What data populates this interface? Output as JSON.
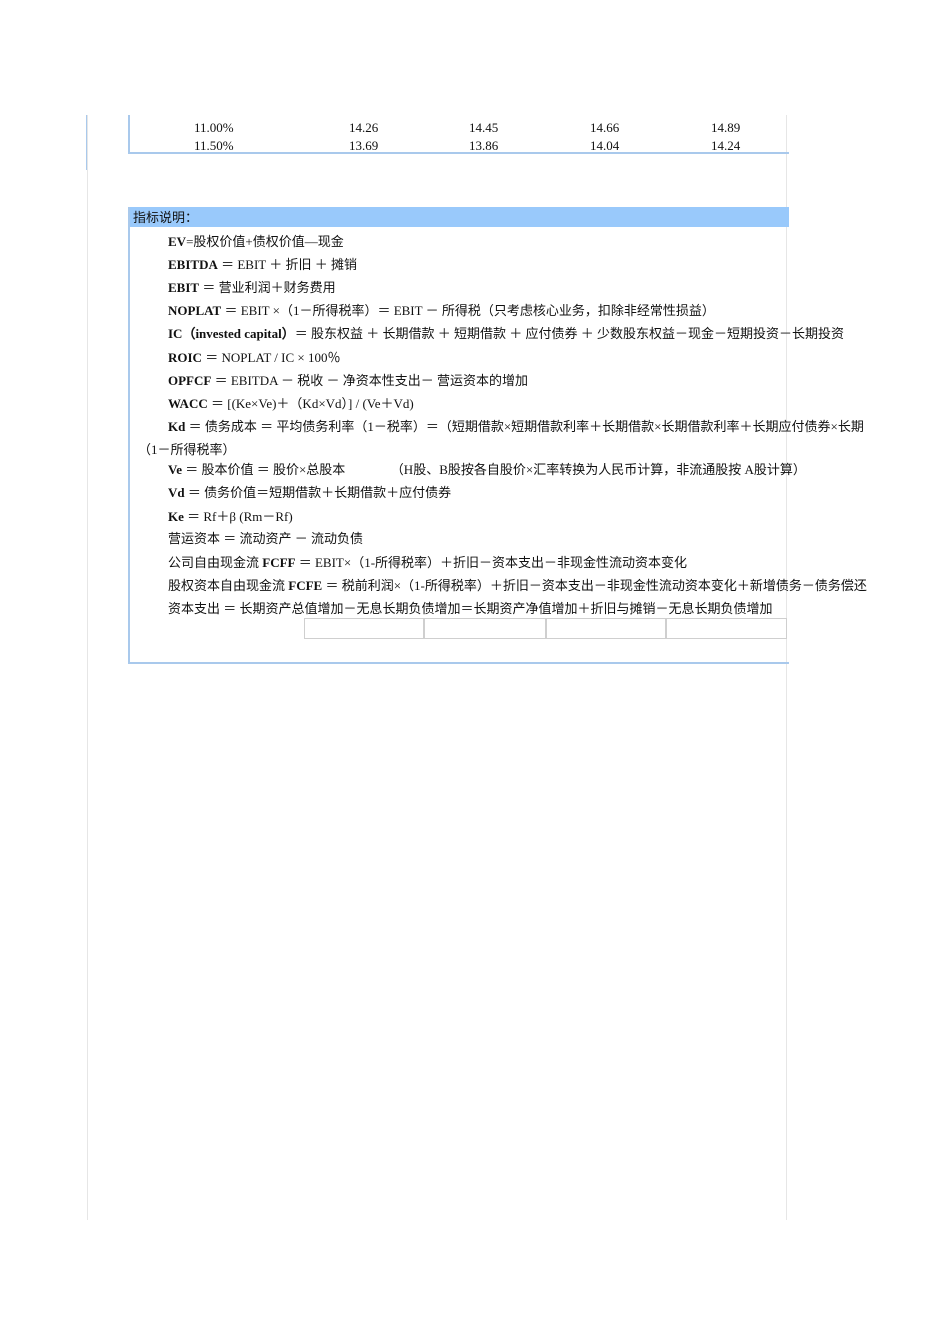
{
  "table": {
    "rows": [
      {
        "rate": "11.00%",
        "values": [
          "14.26",
          "14.45",
          "14.66",
          "14.89"
        ]
      },
      {
        "rate": "11.50%",
        "values": [
          "13.69",
          "13.86",
          "14.04",
          "14.24"
        ]
      }
    ]
  },
  "notes": {
    "header": "指标说明：",
    "lines": [
      {
        "term": "EV",
        "text": "=股权价值+债权价值—现金"
      },
      {
        "term": "EBITDA",
        "text": " ＝ EBIT ＋ 折旧 ＋ 摊销"
      },
      {
        "term": "EBIT",
        "text": " ＝ 营业利润＋财务费用"
      },
      {
        "term": "NOPLAT",
        "text": " ＝ EBIT ×（1－所得税率）＝ EBIT － 所得税（只考虑核心业务，扣除非经常性损益）"
      },
      {
        "term": "IC（invested capital）",
        "text": "＝ 股东权益 ＋ 长期借款 ＋ 短期借款 ＋ 应付债券 ＋ 少数股东权益－现金－短期投资－长期投资"
      },
      {
        "term": "ROIC",
        "text": " ＝ NOPLAT / IC × 100％"
      },
      {
        "term": "OPFCF",
        "text": " ＝ EBITDA － 税收 － 净资本性支出－ 营运资本的增加"
      },
      {
        "term": "WACC",
        "text": " ＝ [(Ke×Ve)＋（Kd×Vd）] / (Ve＋Vd)"
      },
      {
        "term": "Kd",
        "text": " ＝ 债务成本 ＝ 平均债务利率（1－税率）＝（短期借款×短期借款利率＋长期借款×长期借款利率＋长期应付债券×长期"
      },
      {
        "term": "Ve",
        "text": " ＝ 股本价值 ＝ 股价×总股本　　　　（H股、B股按各自股价×汇率转换为人民币计算，非流通股按 A股计算）"
      },
      {
        "term": "Vd",
        "text": " ＝ 债务价值＝短期借款＋长期借款＋应付债券"
      },
      {
        "term": "Ke",
        "text": " ＝  Rf＋β (Rm－Rf)"
      },
      {
        "term": "",
        "text": "营运资本 ＝ 流动资产 － 流动负债"
      },
      {
        "term": "",
        "prefix": "公司自由现金流 ",
        "term2": "FCFF",
        "text": " ＝ EBIT×（1-所得税率）＋折旧－资本支出－非现金性流动资本变化"
      },
      {
        "term": "",
        "prefix": "股权资本自由现金流 ",
        "term2": "FCFE",
        "text": " ＝ 税前利润×（1-所得税率）＋折旧－资本支出－非现金性流动资本变化＋新增债务－债务偿还"
      },
      {
        "term": "",
        "text": "资本支出 ＝ 长期资产总值增加－无息长期负债增加＝长期资产净值增加＋折旧与摊销－无息长期负债增加"
      }
    ],
    "kd_continuation": "（1－所得税率）"
  }
}
